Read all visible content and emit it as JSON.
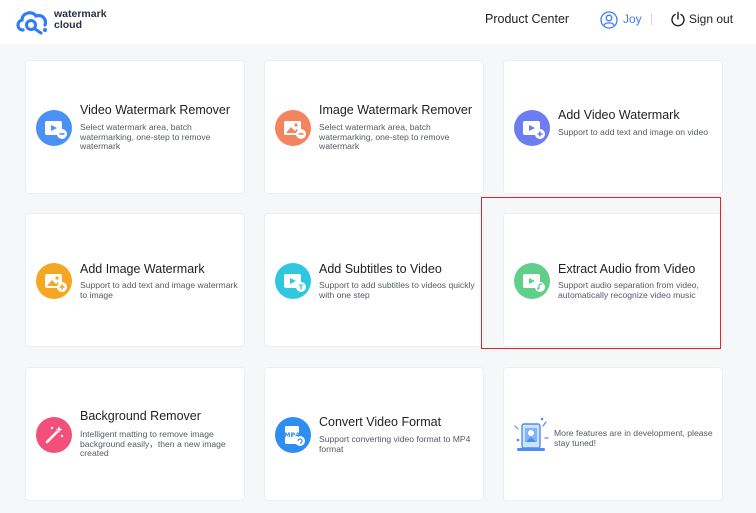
{
  "header": {
    "logo_line1": "watermark",
    "logo_line2": "cloud",
    "product_center": "Product Center",
    "user_name": "Joy",
    "sign_out": "Sign out"
  },
  "cards": [
    {
      "title": "Video Watermark Remover",
      "desc": "Select watermark area, batch watermarking, one-step to remove watermark",
      "icon": "video-remove-icon",
      "color": "#4a90f5"
    },
    {
      "title": "Image Watermark Remover",
      "desc": "Select watermark area, batch watermarking, one-step to remove watermark",
      "icon": "image-remove-icon",
      "color": "#f2845f"
    },
    {
      "title": "Add Video Watermark",
      "desc": "Support to add text and image on video",
      "icon": "video-add-icon",
      "color": "#6b7df0"
    },
    {
      "title": "Add Image Watermark",
      "desc": "Support to add text and image watermark to image",
      "icon": "image-add-icon",
      "color": "#f5a623"
    },
    {
      "title": "Add Subtitles to Video",
      "desc": "Support to add subtitles to videos quickly with one step",
      "icon": "subtitle-icon",
      "color": "#2fc6e0"
    },
    {
      "title": "Extract Audio from Video",
      "desc": "Support audio separation from video, automatically recognize video music",
      "icon": "audio-extract-icon",
      "color": "#5fcf8a"
    },
    {
      "title": "Background Remover",
      "desc": "Intelligent matting to remove image background easily，then a new image created",
      "icon": "magic-wand-icon",
      "color": "#f24f7a"
    },
    {
      "title": "Convert Video Format",
      "desc": "Support converting video format to MP4 format",
      "icon": "mp4-icon",
      "color": "#2f8cf0",
      "badge": "MP4"
    },
    {
      "desc": "More features are in development, please stay tuned!",
      "icon": "development-illustration-icon"
    }
  ]
}
